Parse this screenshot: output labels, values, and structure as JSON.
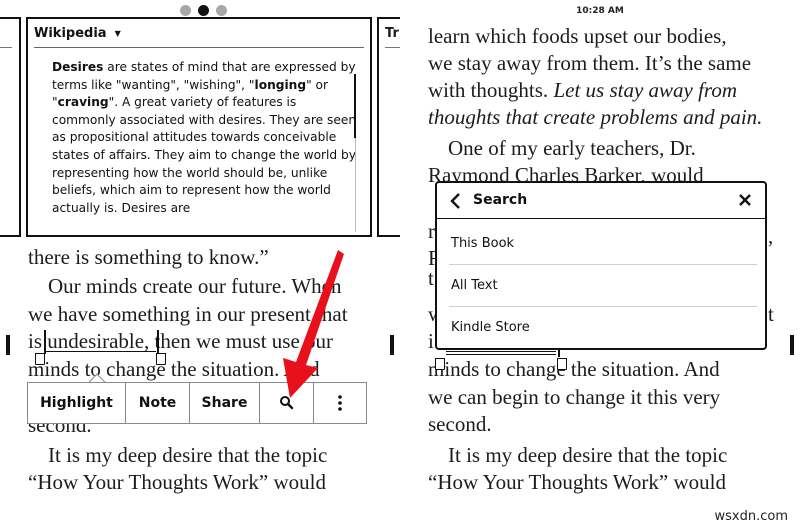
{
  "left_screen": {
    "pagination": {
      "total": 3,
      "active_index": 1
    },
    "lookup_card": {
      "source_label": "Wikipedia",
      "next_card_label": "Tr",
      "body": {
        "term": "Desires",
        "segments": [
          {
            "text": "Desires",
            "bold": true
          },
          {
            "text": " are states of mind that are expressed by terms like \"wanting\", \"wishing\", \"",
            "bold": false
          },
          {
            "text": "longing",
            "bold": true
          },
          {
            "text": "\" or \"",
            "bold": false
          },
          {
            "text": "craving",
            "bold": true
          },
          {
            "text": "\". A great variety of features is commonly associated with desires. They are seen as propositional attitudes towards conceivable states of affairs. They aim to change the world by representing how the world should be, unlike beliefs, which aim to represent how the world actually is. Desires are",
            "bold": false
          }
        ]
      },
      "scroll_position": 0.35
    },
    "book_lines": [
      {
        "text": "there is something to know.”",
        "indent": false
      },
      {
        "text": "Our minds create our future. When",
        "indent": true
      },
      {
        "text": "we have something in our present that",
        "indent": false
      },
      {
        "text": "is undesirable, then we must use our",
        "indent": false
      },
      {
        "text": "minds to change the situation. And",
        "indent": false
      },
      {
        "text": "second.",
        "indent": false
      },
      {
        "text": "It is my deep desire that the topic",
        "indent": true
      },
      {
        "text": "“How Your Thoughts Work” would",
        "indent": false
      }
    ],
    "selected_word": "undesirable,",
    "toolbar": {
      "highlight_label": "Highlight",
      "note_label": "Note",
      "share_label": "Share",
      "search_icon": "search-icon",
      "more_icon": "more-vertical-icon"
    },
    "annotation_color": "#e8101a"
  },
  "right_screen": {
    "clock": "10:28 AM",
    "book_lines": [
      {
        "text": "learn which foods upset our bodies,",
        "indent": false,
        "italic": false
      },
      {
        "text": "we stay away from them. It’s the same",
        "indent": false,
        "italic": false
      },
      {
        "text_plain": "with thoughts. ",
        "text_italic": "Let us stay away from",
        "indent": false
      },
      {
        "text": "thoughts that create problems and pain.",
        "indent": false,
        "italic": true
      },
      {
        "text": "One of my early teachers, Dr.",
        "indent": true,
        "italic": false
      },
      {
        "text": "Raymond Charles Barker, would",
        "indent": false,
        "italic": false
      },
      {
        "text": "minds to change the situation. And",
        "indent": false,
        "italic": false
      },
      {
        "text": "we can begin to change it this very",
        "indent": false,
        "italic": false
      },
      {
        "text": "second.",
        "indent": false,
        "italic": false
      },
      {
        "text": "It is my deep desire that the topic",
        "indent": true,
        "italic": false
      },
      {
        "text": "“How Your Thoughts Work” would",
        "indent": false,
        "italic": false
      }
    ],
    "search_popup": {
      "title": "Search",
      "back_icon": "chevron-left-icon",
      "close_icon": "close-icon",
      "options": [
        "This Book",
        "All Text",
        "Kindle Store"
      ]
    }
  },
  "watermark": "wsxdn.com"
}
